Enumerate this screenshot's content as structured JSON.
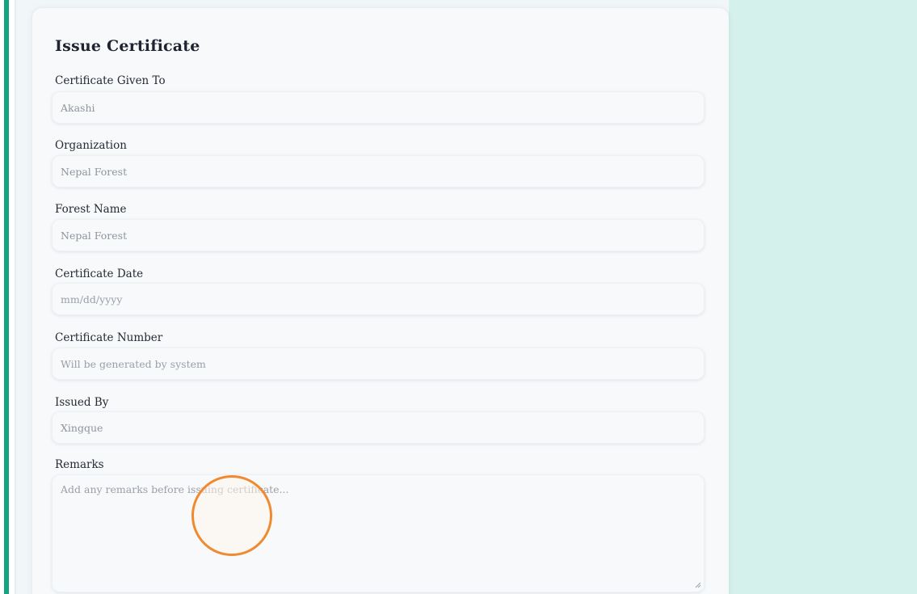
{
  "form": {
    "title": "Issue Certificate",
    "fields": {
      "given_to": {
        "label": "Certificate Given To",
        "value": "Akashi"
      },
      "organization": {
        "label": "Organization",
        "value": "Nepal Forest"
      },
      "forest_name": {
        "label": "Forest Name",
        "value": "Nepal Forest"
      },
      "certificate_date": {
        "label": "Certificate Date",
        "placeholder": "mm/dd/yyyy"
      },
      "certificate_number": {
        "label": "Certificate Number",
        "placeholder": "Will be generated by system"
      },
      "issued_by": {
        "label": "Issued By",
        "value": "Xingque"
      },
      "remarks": {
        "label": "Remarks",
        "placeholder": "Add any remarks before issuing certificate..."
      }
    }
  },
  "colors": {
    "accent": "#14a37f",
    "right_panel": "#d4f1ec",
    "click_indicator": "#f08a30"
  }
}
